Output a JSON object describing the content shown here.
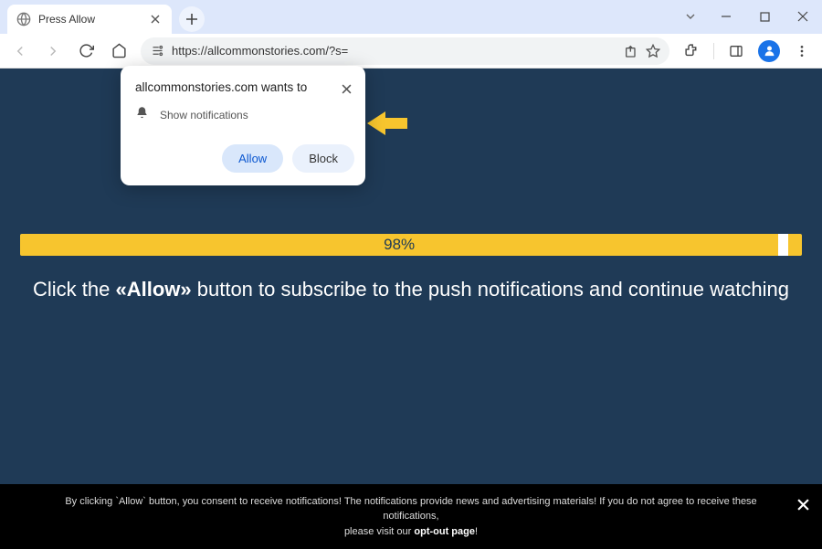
{
  "browser": {
    "tab": {
      "title": "Press Allow"
    },
    "url": "https://allcommonstories.com/?s=",
    "nav": {
      "back_disabled": true,
      "forward_disabled": true
    }
  },
  "permission_popup": {
    "origin_text": "allcommonstories.com wants to",
    "capability": "Show notifications",
    "allow_label": "Allow",
    "block_label": "Block"
  },
  "page": {
    "progress_text": "98%",
    "instruction_prefix": "Click the ",
    "instruction_quoted": "«Allow»",
    "instruction_suffix": " button to subscribe to the push notifications and continue watching"
  },
  "consent": {
    "text_line1": "By clicking `Allow` button, you consent to receive notifications! The notifications provide news and advertising materials! If you do not agree to receive these notifications,",
    "text_line2_prefix": "please visit our ",
    "link_text": "opt-out page",
    "text_line2_suffix": "!"
  }
}
